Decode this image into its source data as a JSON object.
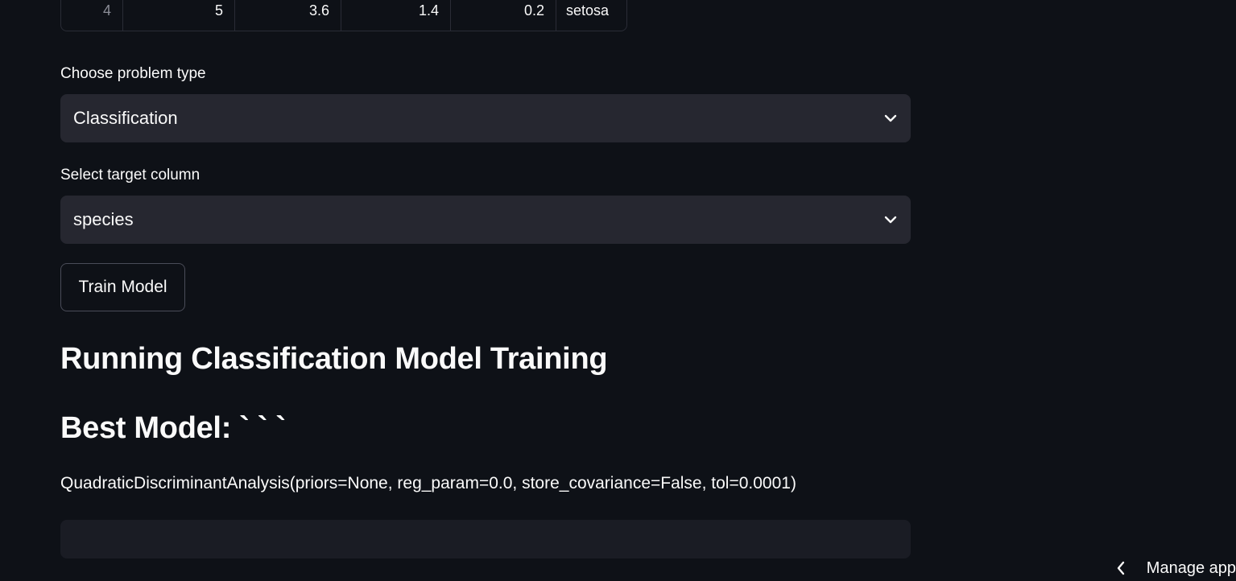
{
  "dataframe": {
    "row": {
      "index": "4",
      "values": [
        "5",
        "3.6",
        "1.4",
        "0.2",
        "setosa"
      ]
    }
  },
  "problem_type": {
    "label": "Choose problem type",
    "selected": "Classification"
  },
  "target_column": {
    "label": "Select target column",
    "selected": "species"
  },
  "train_button": {
    "label": "Train Model"
  },
  "headings": {
    "running": "Running Classification Model Training",
    "best_model": "Best Model: ` ` `"
  },
  "model_repr": "QuadraticDiscriminantAnalysis(priors=None, reg_param=0.0, store_covariance=False, tol=0.0001)",
  "manage_app": {
    "label": "Manage app"
  },
  "colors": {
    "background": "#0e1117",
    "input_bg": "#262730",
    "text": "#fafafa"
  }
}
